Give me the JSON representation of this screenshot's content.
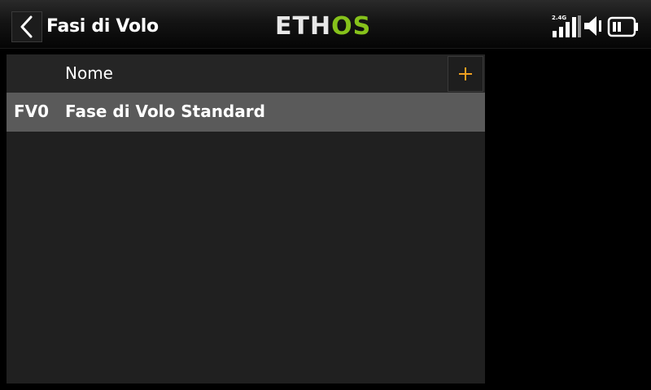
{
  "header": {
    "title": "Fasi di Volo",
    "logo_left": "ETH",
    "logo_right": "OS",
    "band": "2.4G"
  },
  "colors": {
    "accent_plus": "#f0a020",
    "logo_green": "#86c21b",
    "row_selected": "#5a5a5a"
  },
  "table": {
    "column_name": "Nome",
    "add_icon": "plus-icon",
    "rows": [
      {
        "id": "FV0",
        "name": "Fase di Volo Standard"
      }
    ]
  },
  "status": {
    "signal_icon": "signal-bars-icon",
    "speaker_icon": "speaker-icon",
    "battery_icon": "battery-icon"
  }
}
